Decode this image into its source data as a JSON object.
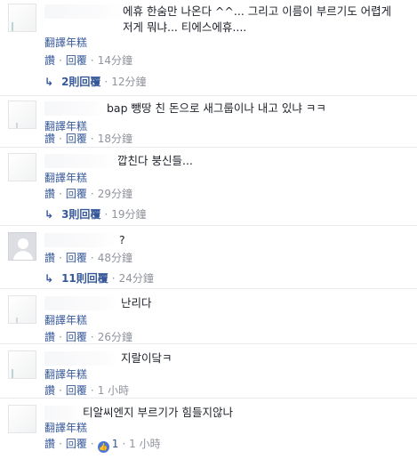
{
  "comments": [
    {
      "text": "에휴 한숨만 나온다 ^^... 그리고 이름이 부르기도 어렵게\n저게 뭐냐... 티에스에휴....",
      "translate": "翻譯年糕",
      "like": "讚",
      "reply": "回覆",
      "time": "14分鐘",
      "replies": {
        "label": "2則回覆",
        "time": "12分鐘"
      }
    },
    {
      "text": "bap 뺑땅 친 돈으로 새그룹이나 내고 있냐 ㅋㅋ",
      "translate": "翻譯年糕",
      "like": "讚",
      "reply": "回覆",
      "time": "18分鐘"
    },
    {
      "text": "깝친다 붕신들...",
      "translate": "翻譯年糕",
      "like": "讚",
      "reply": "回覆",
      "time": "29分鐘",
      "replies": {
        "label": "3則回覆",
        "time": "19分鐘"
      }
    },
    {
      "text": "?",
      "like": "讚",
      "reply": "回覆",
      "time": "48分鐘",
      "replies": {
        "label": "11則回覆",
        "time": "24分鐘"
      }
    },
    {
      "text": "난리다",
      "translate": "翻譯年糕",
      "like": "讚",
      "reply": "回覆",
      "time": "26分鐘"
    },
    {
      "text": "지랄이닼ㅋ",
      "translate": "翻譯年糕",
      "like": "讚",
      "reply": "回覆",
      "time": "1 小時"
    },
    {
      "text": "티알씨엔지 부르기가 힘들지않나",
      "translate": "翻譯年糕",
      "like": "讚",
      "reply": "回覆",
      "reaction_count": "1",
      "time": "1 小時"
    }
  ],
  "icons": {
    "reply_arrow": "reply-arrow-icon",
    "reaction": "like-reaction-icon"
  },
  "colors": {
    "link": "#365899",
    "meta": "#90949c",
    "text": "#1d2129",
    "reaction": "#4a76d6"
  }
}
